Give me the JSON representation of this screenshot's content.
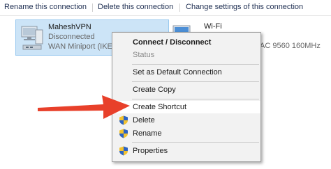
{
  "toolbar": {
    "rename_label": "Rename this connection",
    "delete_label": "Delete this connection",
    "change_settings_label": "Change settings of this connection"
  },
  "connections": {
    "vpn": {
      "name": "MaheshVPN",
      "status": "Disconnected",
      "device": "WAN Miniport (IKEv"
    },
    "wifi": {
      "name": "Wi-Fi",
      "device": "AC 9560 160MHz"
    }
  },
  "context_menu": {
    "connect_disconnect": "Connect / Disconnect",
    "status": "Status",
    "set_default": "Set as Default Connection",
    "create_copy": "Create Copy",
    "create_shortcut": "Create Shortcut",
    "delete": "Delete",
    "rename": "Rename",
    "properties": "Properties"
  },
  "colors": {
    "selection": "#cce4f7",
    "menu_background": "#f2f2f2",
    "arrow": "#e8402a",
    "shield_blue": "#2b63c6",
    "shield_yellow": "#f2c230"
  },
  "icons": {
    "vpn": "network-computer-icon",
    "wifi": "network-computer-icon",
    "uac": "uac-shield-icon"
  }
}
